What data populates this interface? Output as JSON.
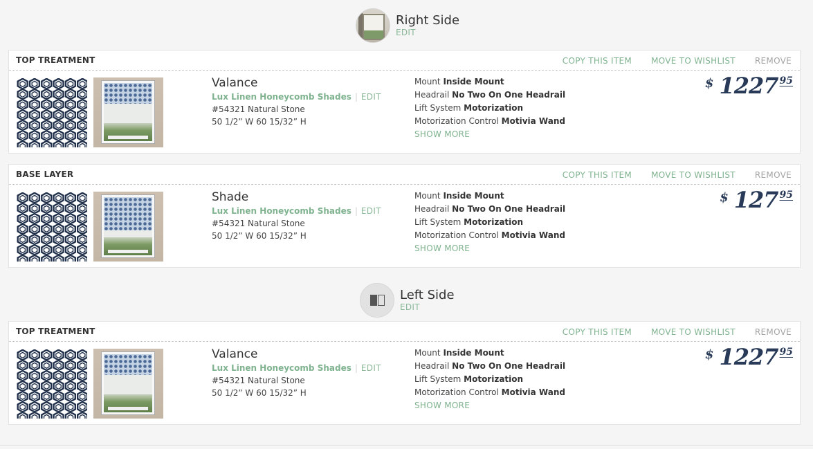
{
  "groups": [
    {
      "title": "Right Side",
      "edit_label": "EDIT",
      "icon": "room-photo-icon",
      "items": [
        {
          "type_label": "TOP TREATMENT",
          "actions": {
            "copy": "COPY THIS ITEM",
            "wishlist": "MOVE TO WISHLIST",
            "remove": "REMOVE"
          },
          "name": "Valance",
          "product_line": "Lux Linen Honeycomb Shades",
          "edit_label": "EDIT",
          "sku_color": "#54321 Natural Stone",
          "dimensions": "50 1/2” W 60 15/32” H",
          "specs": [
            {
              "label": "Mount",
              "value": "Inside Mount"
            },
            {
              "label": "Headrail",
              "value": "No Two On One Headrail"
            },
            {
              "label": "Lift System",
              "value": "Motorization"
            },
            {
              "label": "Motorization Control",
              "value": "Motivia Wand"
            }
          ],
          "show_more": "SHOW MORE",
          "price": {
            "currency": "$",
            "whole": "1227",
            "cents": "95"
          }
        },
        {
          "type_label": "BASE LAYER",
          "actions": {
            "copy": "COPY THIS ITEM",
            "wishlist": "MOVE TO WISHLIST",
            "remove": "REMOVE"
          },
          "name": "Shade",
          "product_line": "Lux Linen Honeycomb Shades",
          "edit_label": "EDIT",
          "sku_color": "#54321 Natural Stone",
          "dimensions": "50 1/2” W 60 15/32” H",
          "specs": [
            {
              "label": "Mount",
              "value": "Inside Mount"
            },
            {
              "label": "Headrail",
              "value": "No Two On One Headrail"
            },
            {
              "label": "Lift System",
              "value": "Motorization"
            },
            {
              "label": "Motorization Control",
              "value": "Motivia Wand"
            }
          ],
          "show_more": "SHOW MORE",
          "price": {
            "currency": "$",
            "whole": "127",
            "cents": "95"
          }
        }
      ]
    },
    {
      "title": "Left Side",
      "edit_label": "EDIT",
      "icon": "split-panels-icon",
      "items": [
        {
          "type_label": "TOP TREATMENT",
          "actions": {
            "copy": "COPY THIS ITEM",
            "wishlist": "MOVE TO WISHLIST",
            "remove": "REMOVE"
          },
          "name": "Valance",
          "product_line": "Lux Linen Honeycomb Shades",
          "edit_label": "EDIT",
          "sku_color": "#54321 Natural Stone",
          "dimensions": "50 1/2” W 60 15/32” H",
          "specs": [
            {
              "label": "Mount",
              "value": "Inside Mount"
            },
            {
              "label": "Headrail",
              "value": "No Two On One Headrail"
            },
            {
              "label": "Lift System",
              "value": "Motorization"
            },
            {
              "label": "Motorization Control",
              "value": "Motivia Wand"
            }
          ],
          "show_more": "SHOW MORE",
          "price": {
            "currency": "$",
            "whole": "1227",
            "cents": "95"
          }
        }
      ]
    }
  ],
  "colors": {
    "accent_green": "#7fb38f",
    "price_navy": "#283a57",
    "muted_gray": "#a3a3a3",
    "swatch_navy": "#1f2f4a"
  }
}
